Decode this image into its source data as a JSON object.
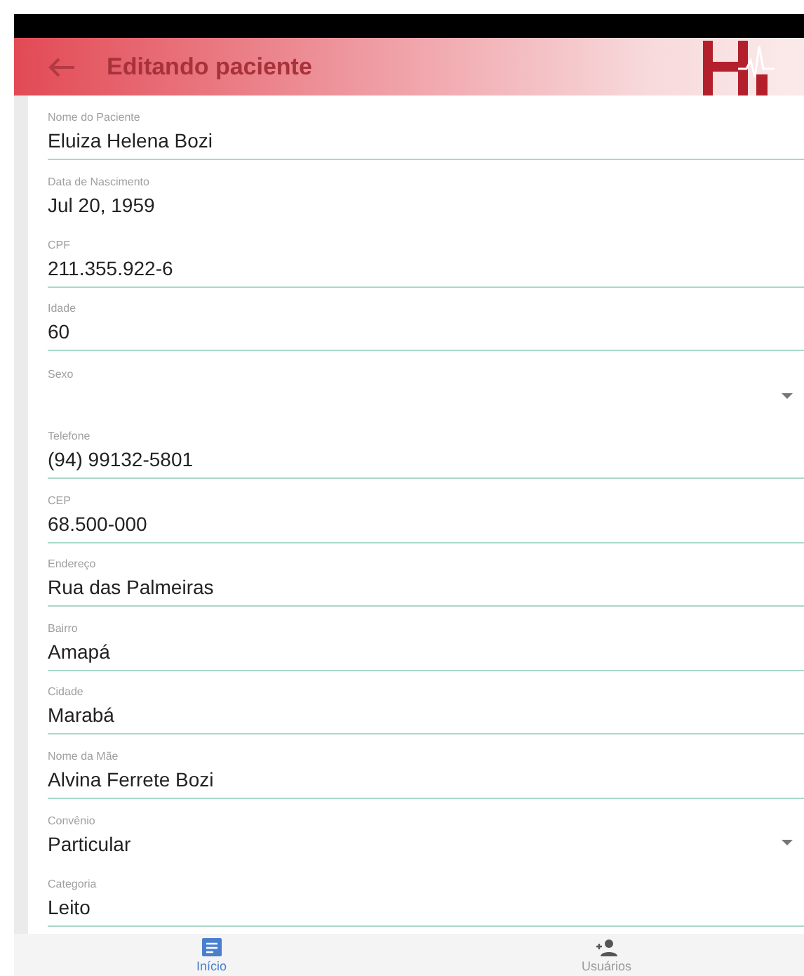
{
  "app_bar": {
    "title": "Editando paciente"
  },
  "fields": [
    {
      "label": "Nome do Paciente",
      "value": "Eluiza Helena Bozi",
      "kind": "text"
    },
    {
      "label": "Data de Nascimento",
      "value": "Jul 20, 1959",
      "kind": "date"
    },
    {
      "label": "CPF",
      "value": "211.355.922-6",
      "kind": "text"
    },
    {
      "label": "Idade",
      "value": "60",
      "kind": "text"
    },
    {
      "label": "Sexo",
      "kind": "select"
    },
    {
      "label": "Telefone",
      "value": "(94) 99132-5801",
      "kind": "text"
    },
    {
      "label": "CEP",
      "value": "68.500-000",
      "kind": "text"
    },
    {
      "label": "Endereço",
      "value": "Rua das Palmeiras",
      "kind": "text"
    },
    {
      "label": "Bairro",
      "value": "Amapá",
      "kind": "text"
    },
    {
      "label": "Cidade",
      "value": "Marabá",
      "kind": "text"
    },
    {
      "label": "Nome da Mãe",
      "value": "Alvina Ferrete Bozi",
      "kind": "text"
    },
    {
      "label": "Convênio",
      "value": "Particular",
      "kind": "select"
    },
    {
      "label": "Categoria",
      "value": "Leito",
      "kind": "text"
    }
  ],
  "bottom_nav": [
    {
      "label": "Início",
      "selected": true,
      "kind": "home"
    },
    {
      "label": "Usuários",
      "selected": false,
      "kind": "users"
    }
  ]
}
